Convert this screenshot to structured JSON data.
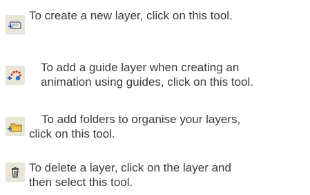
{
  "tools": [
    {
      "icon": "new-layer-icon",
      "lines": [
        "To create a new layer, click on this tool."
      ]
    },
    {
      "icon": "add-guide-layer-icon",
      "lines": [
        "To add a guide layer when creating an",
        "animation using guides, click on this tool."
      ]
    },
    {
      "icon": "add-folder-icon",
      "lines": [
        "To add folders to organise your layers,",
        "click on this tool."
      ]
    },
    {
      "icon": "delete-layer-icon",
      "lines": [
        "To delete a layer, click on the layer and",
        "then select this tool."
      ]
    }
  ],
  "colors": {
    "text": "#3a3a3a",
    "icon_background": "#e9e4d6",
    "icon_blue": "#2f6fb8",
    "icon_red": "#d43a2a",
    "icon_yellow": "#f2c84b"
  }
}
